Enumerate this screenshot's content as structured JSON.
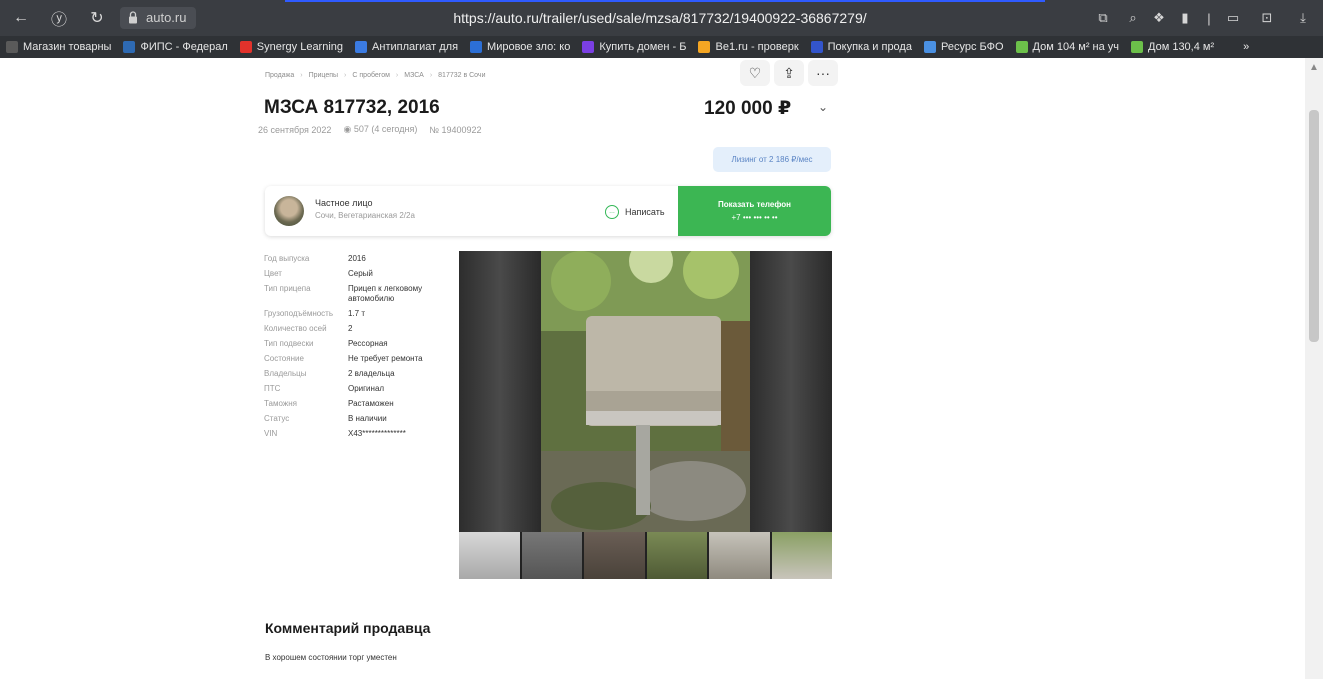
{
  "browser": {
    "domain": "auto.ru",
    "url": "https://auto.ru/trailer/used/sale/mzsa/817732/19400922-36867279/"
  },
  "bookmarks": [
    {
      "label": "Магазин товарны",
      "color": "#5a5a5a"
    },
    {
      "label": "ФИПС - Федерал",
      "color": "#2e6ab3"
    },
    {
      "label": "Synergy Learning",
      "color": "#e2322b"
    },
    {
      "label": "Антиплагиат для",
      "color": "#3b7be2"
    },
    {
      "label": "Мировое зло: ко",
      "color": "#2c6fd6"
    },
    {
      "label": "Купить домен - Б",
      "color": "#7b3fe4"
    },
    {
      "label": "Be1.ru - проверк",
      "color": "#f5a623"
    },
    {
      "label": "Покупка и прода",
      "color": "#3355cc"
    },
    {
      "label": "Ресурс БФО",
      "color": "#4a90e2"
    },
    {
      "label": "Дом 104 м² на уч",
      "color": "#6cc04a"
    },
    {
      "label": "Дом 130,4 м²",
      "color": "#6cc04a"
    },
    {
      "label": "»",
      "color": "#2f3236"
    }
  ],
  "breadcrumb": [
    "Продажа",
    "Прицепы",
    "С пробегом",
    "МЗСА",
    "817732 в Сочи"
  ],
  "listing": {
    "title": "МЗСА 817732, 2016",
    "price": "120 000 ₽",
    "date": "26 сентября 2022",
    "views": "507 (4 сегодня)",
    "number": "№ 19400922",
    "leasing": "Лизинг от 2 186 ₽/мес"
  },
  "seller": {
    "type": "Частное лицо",
    "address": "Сочи, Вегетарианская 2/2а",
    "write_label": "Написать",
    "show_phone_label": "Показать телефон",
    "phone_masked": "+7 ••• ••• •• ••"
  },
  "specs": [
    {
      "k": "Год выпуска",
      "v": "2016"
    },
    {
      "k": "Цвет",
      "v": "Серый"
    },
    {
      "k": "Тип прицепа",
      "v": "Прицеп к легковому автомобилю"
    },
    {
      "k": "Грузоподъёмность",
      "v": "1.7 т"
    },
    {
      "k": "Количество осей",
      "v": "2"
    },
    {
      "k": "Тип подвески",
      "v": "Рессорная"
    },
    {
      "k": "Состояние",
      "v": "Не требует ремонта"
    },
    {
      "k": "Владельцы",
      "v": "2 владельца"
    },
    {
      "k": "ПТС",
      "v": "Оригинал"
    },
    {
      "k": "Таможня",
      "v": "Растаможен"
    },
    {
      "k": "Статус",
      "v": "В наличии"
    },
    {
      "k": "VIN",
      "v": "X43**************"
    }
  ],
  "comment": {
    "heading": "Комментарий продавца",
    "text": "В хорошем состоянии торг уместен"
  },
  "colors": {
    "accent_green": "#3cb653",
    "leasing_bg": "#e4effb",
    "leasing_text": "#5a84c4"
  }
}
